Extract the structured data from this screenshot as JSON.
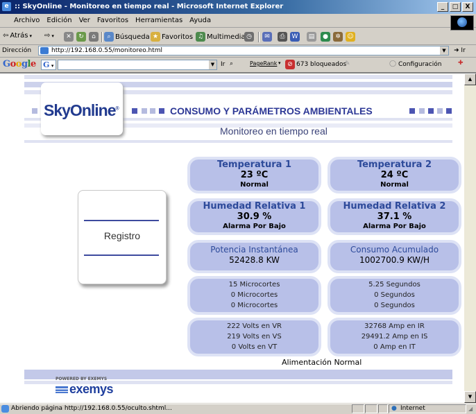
{
  "window": {
    "title": ":: SkyOnline - Monitoreo en tiempo real - Microsoft Internet Explorer",
    "controls": [
      "_",
      "□",
      "X"
    ]
  },
  "menu": [
    "Archivo",
    "Edición",
    "Ver",
    "Favoritos",
    "Herramientas",
    "Ayuda"
  ],
  "toolbar": {
    "back": "Atrás",
    "search": "Búsqueda",
    "favorites": "Favoritos",
    "multimedia": "Multimedia"
  },
  "address": {
    "label": "Dirección",
    "url": "http://192.168.0.55/monitoreo.html",
    "go": "Ir"
  },
  "google": {
    "logo": "Google",
    "g_button": "G",
    "go": "Ir",
    "pagerank": "PageRank",
    "blocked": "673 bloqueados",
    "settings": "Configuración"
  },
  "page": {
    "logo": "SkyOnline",
    "trademark": "®",
    "title": "CONSUMO Y PARÁMETROS AMBIENTALES",
    "subtitle": "Monitoreo en tiempo real",
    "registro": "Registro",
    "panels": {
      "temp1": {
        "label": "Temperatura 1",
        "value": "23 ºC",
        "status": "Normal"
      },
      "temp2": {
        "label": "Temperatura 2",
        "value": "24 ºC",
        "status": "Normal"
      },
      "hum1": {
        "label": "Humedad Relativa 1",
        "value": "30.9 %",
        "status": "Alarma Por Bajo"
      },
      "hum2": {
        "label": "Humedad Relativa 2",
        "value": "37.1 %",
        "status": "Alarma Por Bajo"
      },
      "power": {
        "label": "Potencia Instantánea",
        "value": "52428.8 KW"
      },
      "consumption": {
        "label": "Consumo Acumulado",
        "value": "1002700.9 KW/H"
      },
      "microcuts": [
        "15 Microcortes",
        "0 Microcortes",
        "0 Microcortes"
      ],
      "seconds": [
        "5.25 Segundos",
        "0 Segundos",
        "0 Segundos"
      ],
      "volts": [
        "222 Volts en VR",
        "219 Volts en VS",
        "0 Volts en VT"
      ],
      "amps": [
        "32768 Amp en IR",
        "29491.2 Amp en IS",
        "0 Amp en IT"
      ]
    },
    "supply_status": "Alimentación Normal",
    "powered_by": "POWERED BY EXEMYS",
    "brand": "exemys"
  },
  "status": {
    "message": "Abriendo página http://192.168.0.55/oculto.shtml...",
    "zone": "Internet"
  }
}
